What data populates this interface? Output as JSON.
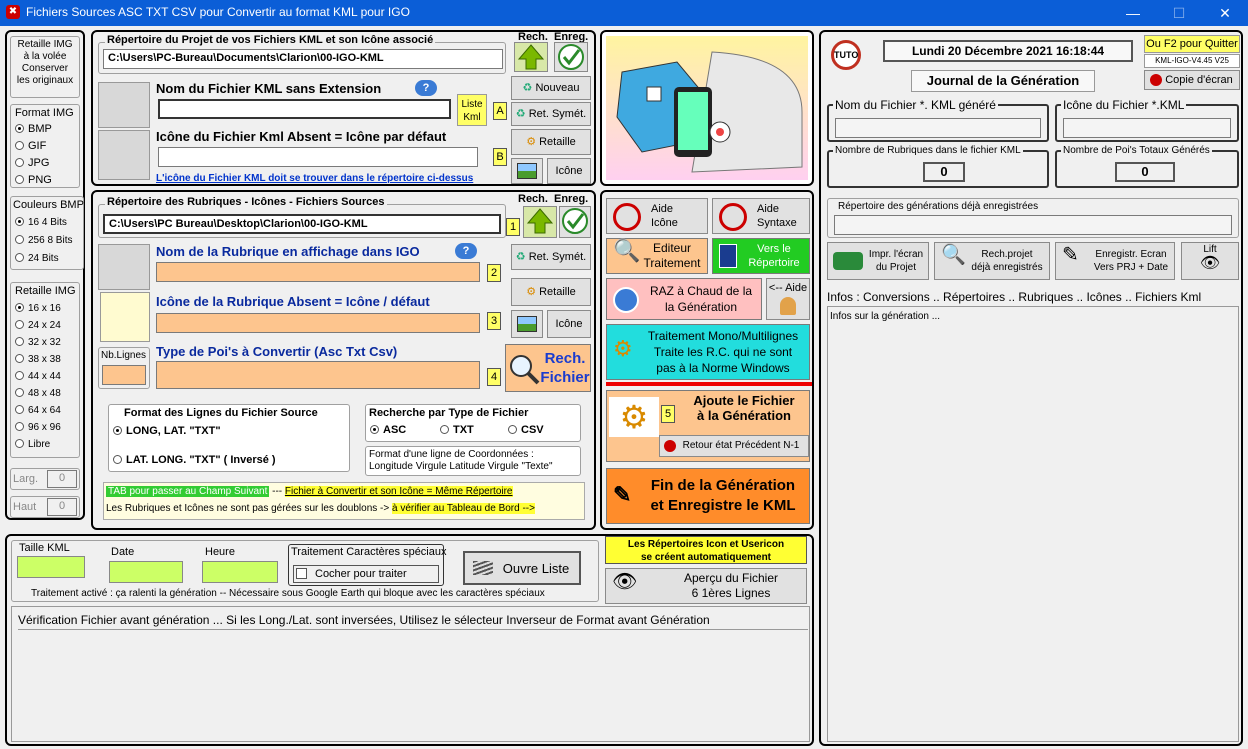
{
  "window": {
    "title": "Fichiers Sources ASC TXT CSV pour Convertir au format KML pour IGO",
    "minimize": "—",
    "maximize": "☐",
    "close": "✕"
  },
  "left": {
    "retaille": "Retaille IMG\nà la volée\nConserver\nles originaux",
    "format_title": "Format IMG",
    "formats": [
      "BMP",
      "GIF",
      "JPG",
      "PNG"
    ],
    "colors_title": "Couleurs BMP",
    "colors": [
      "16 4 Bits",
      "256 8 Bits",
      "24 Bits"
    ],
    "retaille_title": "Retaille IMG",
    "sizes": [
      "16 x 16",
      "24 x 24",
      "32 x 32",
      "38 x 38",
      "44 x 44",
      "48 x 48",
      "64 x 64",
      "96 x 96",
      "Libre"
    ],
    "larg": "Larg.",
    "haut": "Haut",
    "larg_val": "0",
    "haut_val": "0"
  },
  "project": {
    "repertoire_label": "Répertoire du Projet de vos Fichiers KML et son Icône associé",
    "repertoire_value": "C:\\Users\\PC-Bureau\\Documents\\Clarion\\00-IGO-KML",
    "rech": "Rech.",
    "enreg": "Enreg.",
    "nom_label": "Nom du Fichier KML sans Extension",
    "nom_value": "",
    "liste_kml": "Liste Kml",
    "a": "A",
    "b": "B",
    "icone_label": "Icône du Fichier Kml Absent = Icône par défaut",
    "icone_note": "L'icône du Fichier KML doit se trouver dans le répertoire ci-dessus",
    "nouveau": "Nouveau",
    "ret_symet": "Ret. Symét.",
    "retaille": "Retaille",
    "icone": "Icône"
  },
  "rubriques": {
    "repertoire_label": "Répertoire des Rubriques - Icônes - Fichiers Sources",
    "repertoire_value": "C:\\Users\\PC Bureau\\Desktop\\Clarion\\00-IGO-KML",
    "rech": "Rech.",
    "enreg": "Enreg.",
    "nom_label": "Nom de la Rubrique en affichage dans IGO",
    "icone_label": "Icône de la Rubrique  Absent = Icône / défaut",
    "type_label": "Type de Poi's à Convertir (Asc Txt  Csv)",
    "nb_lignes": "Nb.Lignes",
    "n1": "1",
    "n2": "2",
    "n3": "3",
    "n4": "4",
    "ret_symet": "Ret. Symét.",
    "retaille": "Retaille",
    "icone": "Icône",
    "rech_fichier": "Rech. Fichier",
    "format_title": "Format des Lignes du Fichier Source",
    "format_opt1": "LONG,  LAT.   \"TXT\"",
    "format_opt2": "LAT.  LONG.   \"TXT\"   ( Inversé )",
    "recherche_title": "Recherche par Type de  Fichier",
    "types": [
      "ASC",
      "TXT",
      "CSV"
    ],
    "format_ligne": "Format d'une ligne de Coordonnées :\nLongitude Virgule Latitude Virgule \"Texte\"",
    "tab_note": "TAB  pour passer au Champ Suivant",
    "sep": " --- ",
    "meme_rep": "Fichier à Convertir et son Icône = Même Répertoire",
    "doublons": "Les Rubriques et Icônes ne sont pas gérées sur les doublons -> ",
    "verifier": "à vérifier au Tableau de Bord -->"
  },
  "middle": {
    "aide_icone": "Aide\nIcône",
    "aide_syntaxe": "Aide\nSyntaxe",
    "editeur": "Editeur\nTraitement",
    "vers_rep": "Vers le\nRépertoire",
    "raz": "RAZ à Chaud de la\nla Génération",
    "aide": "<-- Aide",
    "traitement": "Traitement Mono/Multilignes\nTraite les R.C. qui ne sont\npas à la Norme Windows",
    "n5": "5",
    "ajoute": "Ajoute le Fichier\nà la Génération",
    "retour": "Retour état Précédent N-1",
    "fin": "Fin de la Génération\net Enregistre le KML",
    "rep_auto": "Les Répertoires Icon et Usericon\nse créent automatiquement",
    "apercu": "Aperçu du  Fichier\n6 1ères Lignes"
  },
  "right": {
    "tuto": "TUTO",
    "datetime": "Lundi 20 Décembre  2021  16:18:44",
    "quit": "Ou F2 pour Quitter",
    "version": "KML-IGO-V4.45 V25",
    "copie": "Copie d'écran",
    "journal": "Journal de la Génération",
    "nom_kml": "Nom du Fichier *. KML généré",
    "icone_kml": "Icône du Fichier *.KML",
    "nb_rubriques": "Nombre de Rubriques dans le fichier KML",
    "nb_pois": "Nombre de Poi's Totaux Générés",
    "nb_rubriques_val": "0",
    "nb_pois_val": "0",
    "rep_gen": "Répertoire des générations déjà enregistrées",
    "impr": "Impr. l'écran\ndu Projet",
    "rech_projet": "Rech.projet\ndéjà enregistrés",
    "enregistr": "Enregistr. Ecran\nVers PRJ + Date",
    "lift": "Lift",
    "infos_title": "Infos :  Conversions .. Répertoires .. Rubriques .. Icônes .. Fichiers Kml",
    "infos_text": "Infos sur la génération ..."
  },
  "bottom": {
    "taille": "Taille KML",
    "date": "Date",
    "heure": "Heure",
    "trait_title": "Traitement Caractères spéciaux",
    "cocher": "Cocher pour traiter",
    "ouvre": "Ouvre Liste",
    "trait_note": "Traitement activé : ça ralenti la génération -- Nécessaire sous Google Earth qui bloque avec les caractères spéciaux",
    "verif": "Vérification Fichier avant génération ...  Si les Long./Lat. sont inversées,  Utilisez  le sélecteur Inverseur de Format avant Génération"
  }
}
